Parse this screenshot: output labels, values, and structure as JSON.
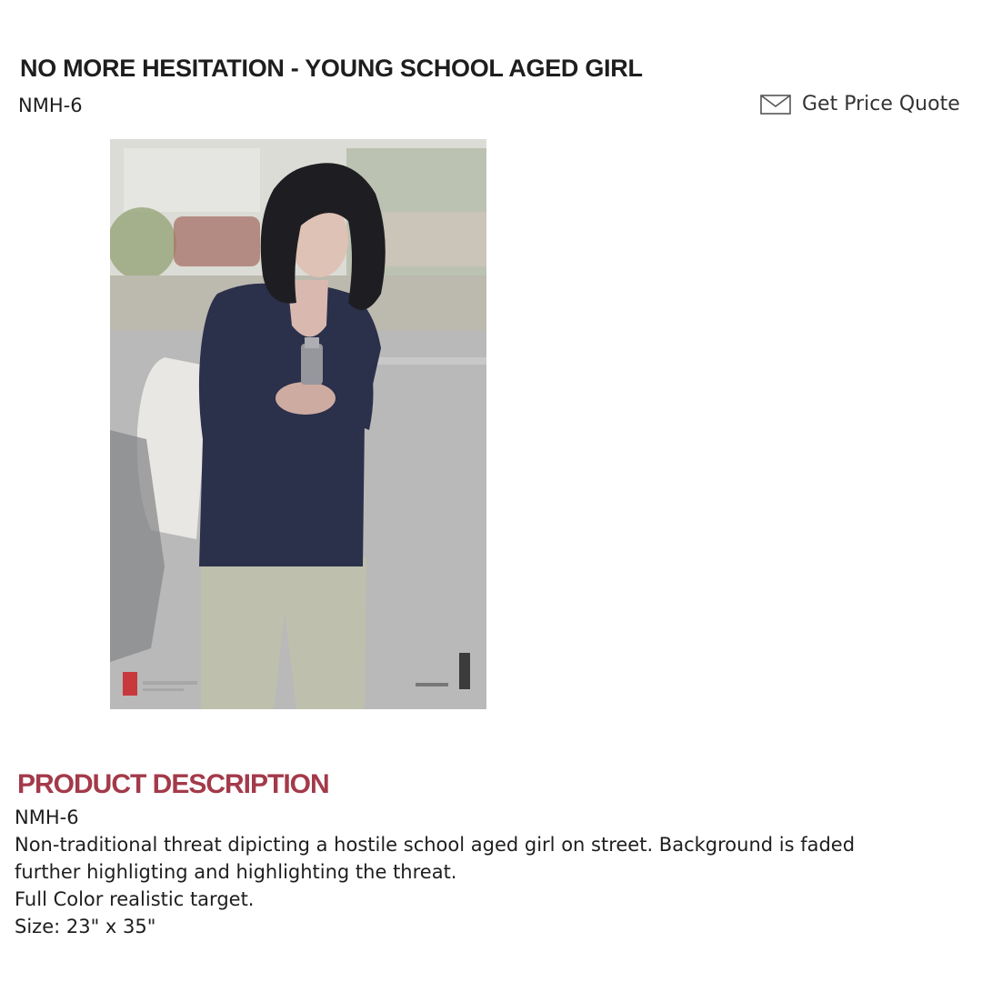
{
  "product": {
    "title": "NO MORE HESITATION - YOUNG SCHOOL AGED GIRL",
    "sku": "NMH-6",
    "quote_label": "Get Price Quote"
  },
  "image": {
    "alt": "Young school aged girl pointing handgun",
    "brand_mark": "LET",
    "code_mark": "NMH-6"
  },
  "description": {
    "heading": "PRODUCT DESCRIPTION",
    "sku_line": "NMH-6",
    "line1": "Non-traditional threat dipicting a hostile school aged girl on street. Background is faded",
    "line2": "further highligting and highlighting the threat.",
    "line3": "Full Color realistic target.",
    "line4": "Size: 23\" x 35\""
  },
  "colors": {
    "heading_accent": "#a33a4a",
    "text": "#1e1e1e"
  },
  "icons": {
    "quote": "envelope-icon"
  }
}
